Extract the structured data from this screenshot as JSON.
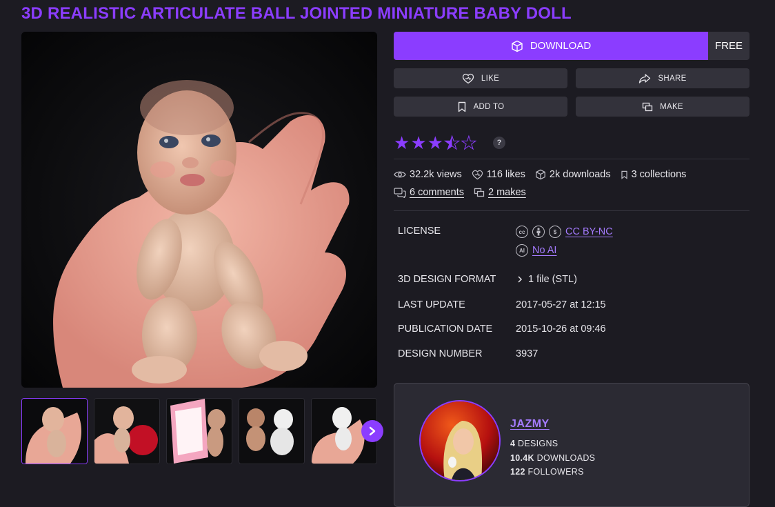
{
  "title": "3D REALISTIC ARTICULATE BALL JOINTED MINIATURE BABY DOLL",
  "actions": {
    "download_label": "DOWNLOAD",
    "price": "FREE",
    "like_label": "LIKE",
    "share_label": "SHARE",
    "add_to_label": "ADD TO",
    "make_label": "MAKE"
  },
  "rating": {
    "stars_filled": 3.5,
    "stars_total": 5,
    "help": "?"
  },
  "stats": {
    "views": "32.2k views",
    "likes": "116 likes",
    "downloads": "2k downloads",
    "collections": "3 collections",
    "comments": "6 comments",
    "makes": "2 makes"
  },
  "details": {
    "license_label": "LICENSE",
    "license_value": "CC BY-NC",
    "ai_value": "No AI",
    "format_label": "3D DESIGN FORMAT",
    "format_value": "1 file (STL)",
    "update_label": "LAST UPDATE",
    "update_value": "2017-05-27 at 12:15",
    "publication_label": "PUBLICATION DATE",
    "publication_value": "2015-10-26 at 09:46",
    "number_label": "DESIGN NUMBER",
    "number_value": "3937"
  },
  "creator": {
    "name": "JAZMY",
    "designs_count": "4",
    "designs_label": "DESIGNS",
    "downloads_count": "10.4K",
    "downloads_label": "DOWNLOADS",
    "followers_count": "122",
    "followers_label": "FOLLOWERS"
  },
  "colors": {
    "accent": "#8b3dff",
    "background": "#1c1b22",
    "button": "#33323b",
    "link": "#a57bff"
  },
  "icons": [
    "cube-icon",
    "heart-icon",
    "share-icon",
    "bookmark-icon",
    "make-icon",
    "eye-icon",
    "comment-icon",
    "chevron-right-icon"
  ]
}
